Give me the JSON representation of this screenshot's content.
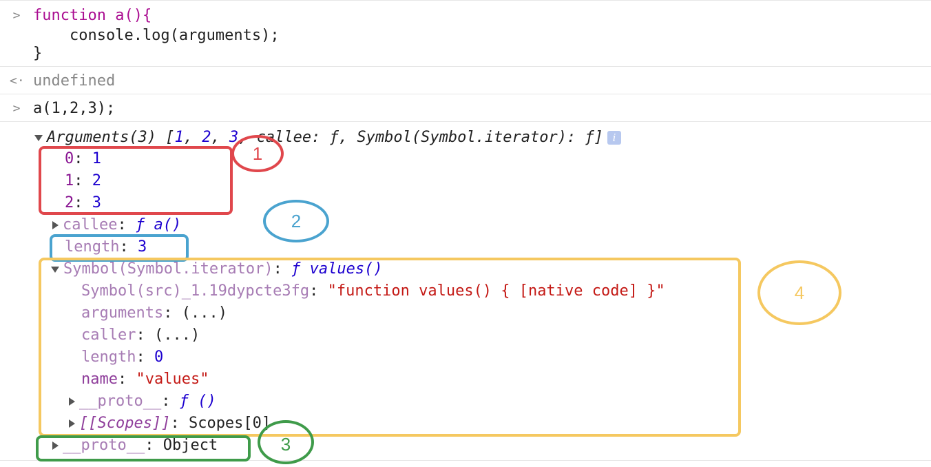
{
  "console": {
    "input1": {
      "line1": "function a(){",
      "line2": "    console.log(arguments);",
      "line3": "}"
    },
    "output1": "undefined",
    "input2": "a(1,2,3);",
    "summary": {
      "label": "Arguments(3) [",
      "v1": "1",
      "v2": "2",
      "v3": "3",
      "rest": ", callee: ƒ, Symbol(Symbol.iterator): ƒ]"
    },
    "entries": [
      {
        "key": "0",
        "value": "1"
      },
      {
        "key": "1",
        "value": "2"
      },
      {
        "key": "2",
        "value": "3"
      }
    ],
    "callee": {
      "key": "callee",
      "value": "ƒ a()"
    },
    "length": {
      "key": "length",
      "value": "3"
    },
    "iterator": {
      "key": "Symbol(Symbol.iterator)",
      "value": "ƒ values()",
      "props": [
        {
          "key": "Symbol(src)_1.19dypcte3fg",
          "value": "\"function values() { [native code] }\""
        },
        {
          "key": "arguments",
          "value": "(...)"
        },
        {
          "key": "caller",
          "value": "(...)"
        },
        {
          "key": "length",
          "value": "0"
        },
        {
          "key": "name",
          "value": "\"values\""
        }
      ],
      "proto": {
        "key": "__proto__",
        "value": "ƒ ()"
      },
      "scopes": {
        "key": "[[Scopes]]",
        "value": "Scopes[0]"
      }
    },
    "proto": {
      "key": "__proto__",
      "value": "Object"
    }
  },
  "annotations": [
    {
      "label": "1",
      "color": "#e0474c"
    },
    {
      "label": "2",
      "color": "#4aa3cf"
    },
    {
      "label": "3",
      "color": "#3f9b4a"
    },
    {
      "label": "4",
      "color": "#f5c860"
    }
  ],
  "icons": {
    "prompt": "chevron-right-icon",
    "result": "return-arrow-icon",
    "info": "info-icon"
  }
}
